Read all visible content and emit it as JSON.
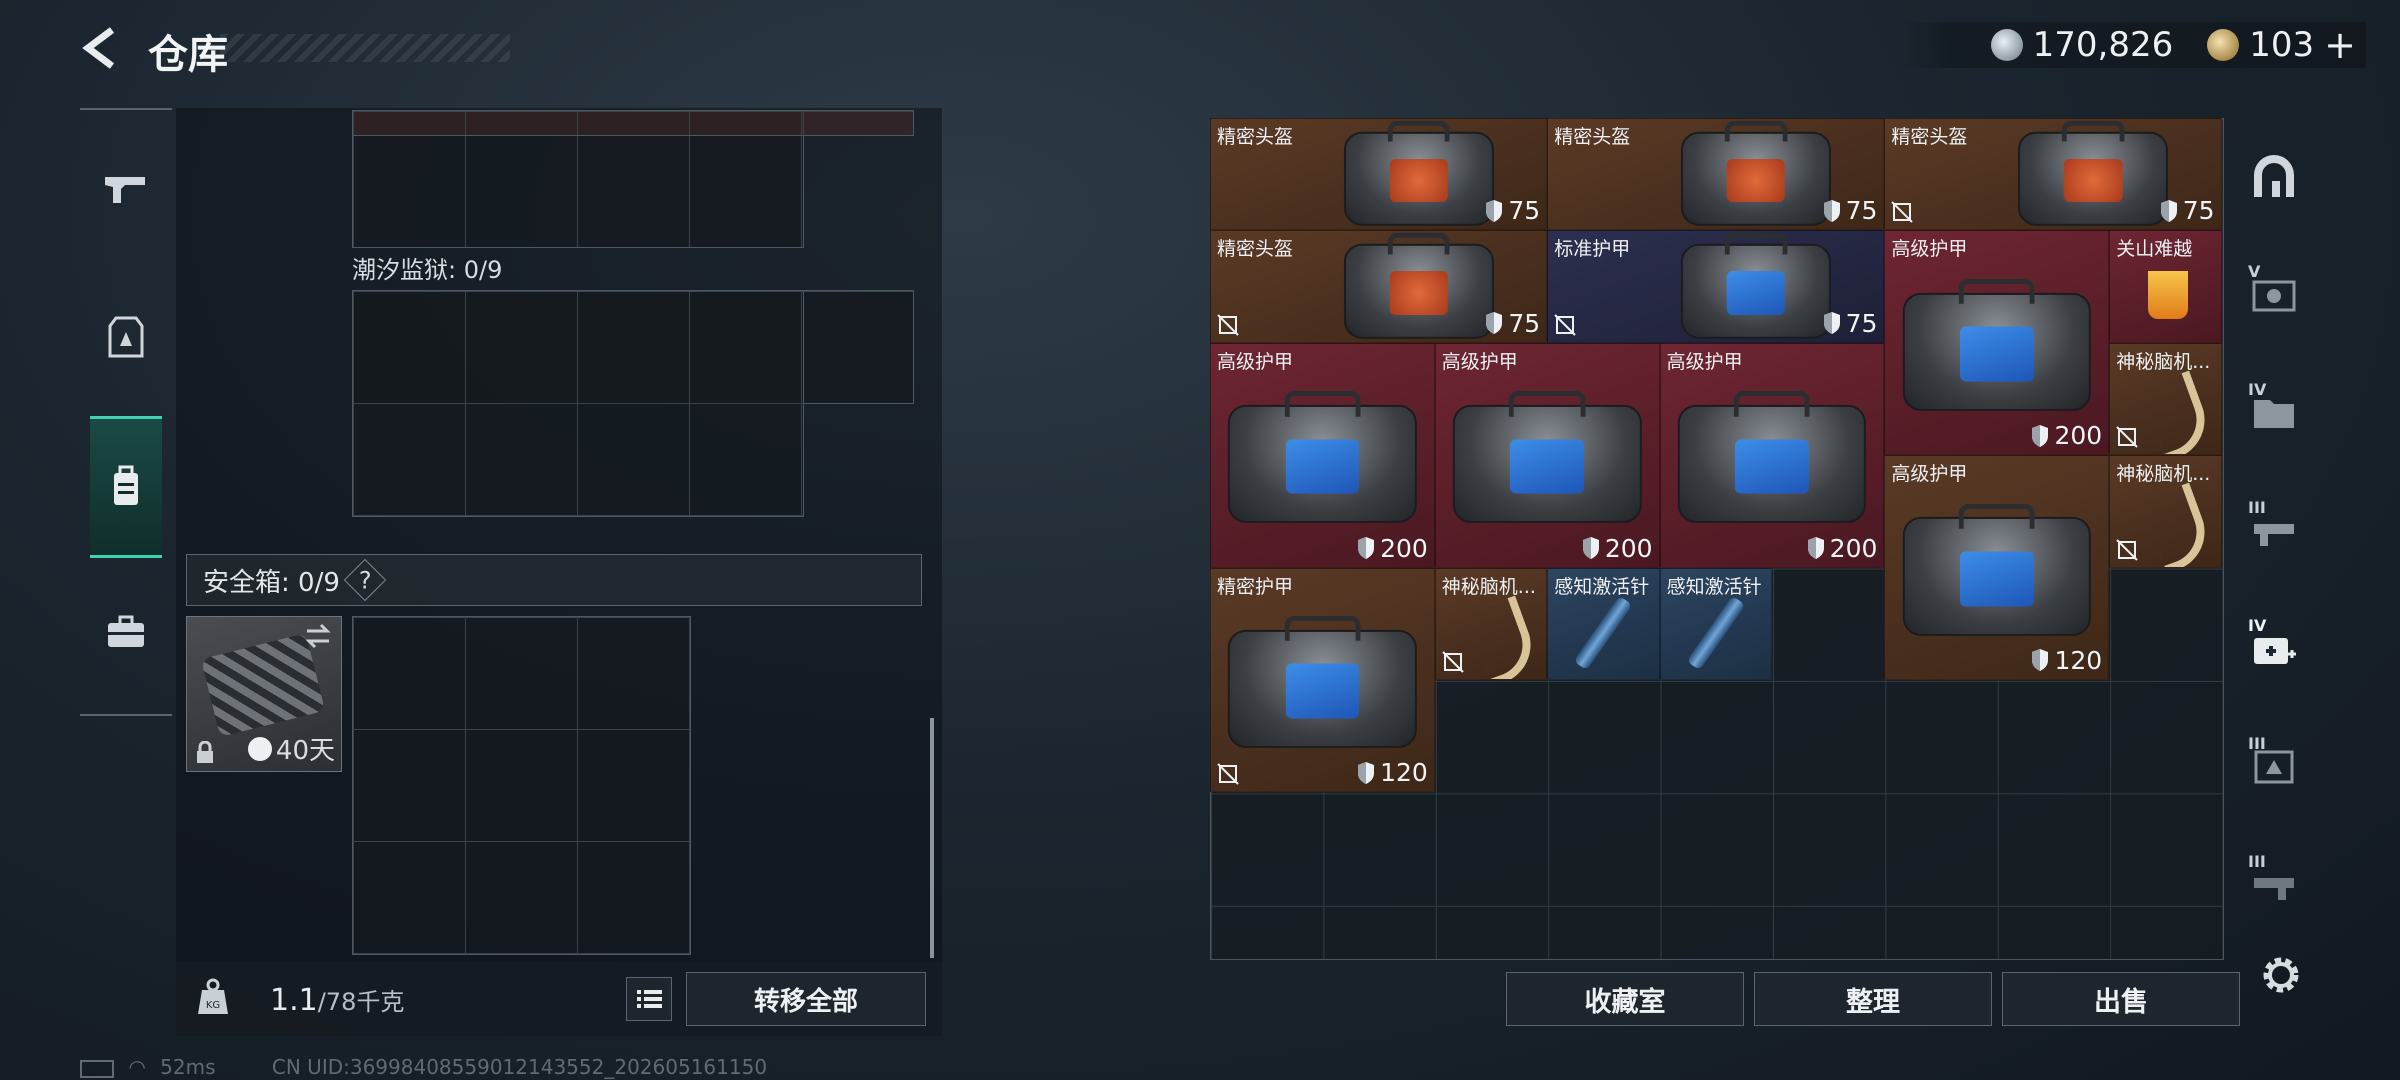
{
  "header": {
    "title": "仓库"
  },
  "currency": {
    "silver": "170,826",
    "gold": "103",
    "gold_add": "+"
  },
  "left": {
    "tide_prison_label": "潮汐监狱: 0/9",
    "safebox_label": "安全箱: 0/9",
    "safebox_help": "?",
    "safebox_timer": "40天",
    "weight_value": "1.1",
    "weight_max": "/78千克",
    "transfer_all": "转移全部"
  },
  "stash_items": [
    {
      "name": "精密头盔",
      "durability": "75",
      "color": "brown",
      "icon": "helmet-bag-icon",
      "nontransfer": false
    },
    {
      "name": "精密头盔",
      "durability": "75",
      "color": "brown",
      "icon": "helmet-bag-icon",
      "nontransfer": false
    },
    {
      "name": "精密头盔",
      "durability": "75",
      "color": "brown",
      "icon": "helmet-bag-icon",
      "nontransfer": true
    },
    {
      "name": "精密头盔",
      "durability": "75",
      "color": "brown",
      "icon": "helmet-bag-icon",
      "nontransfer": true
    },
    {
      "name": "标准护甲",
      "durability": "75",
      "color": "navy",
      "icon": "armor-bag-icon",
      "nontransfer": true
    },
    {
      "name": "高级护甲",
      "durability": "200",
      "color": "red",
      "icon": "armor-bag-icon",
      "nontransfer": false
    },
    {
      "name": "关山难越",
      "durability": "",
      "color": "red",
      "icon": "drink-icon",
      "nontransfer": false
    },
    {
      "name": "高级护甲",
      "durability": "200",
      "color": "red",
      "icon": "armor-bag-icon",
      "nontransfer": false
    },
    {
      "name": "高级护甲",
      "durability": "200",
      "color": "red",
      "icon": "armor-bag-icon",
      "nontransfer": false
    },
    {
      "name": "高级护甲",
      "durability": "200",
      "color": "red",
      "icon": "armor-bag-icon",
      "nontransfer": false
    },
    {
      "name": "神秘脑机...",
      "durability": "",
      "color": "brown",
      "icon": "brain-device-icon",
      "nontransfer": true
    },
    {
      "name": "高级护甲",
      "durability": "120",
      "color": "brown",
      "icon": "armor-bag-icon",
      "nontransfer": false
    },
    {
      "name": "神秘脑机...",
      "durability": "",
      "color": "brown",
      "icon": "brain-device-icon",
      "nontransfer": true
    },
    {
      "name": "精密护甲",
      "durability": "120",
      "color": "brown",
      "icon": "armor-bag-icon",
      "nontransfer": true
    },
    {
      "name": "神秘脑机...",
      "durability": "",
      "color": "brown",
      "icon": "brain-device-icon",
      "nontransfer": true
    },
    {
      "name": "感知激活针",
      "durability": "",
      "color": "blue",
      "icon": "syringe-icon",
      "nontransfer": false
    },
    {
      "name": "感知激活针",
      "durability": "",
      "color": "blue",
      "icon": "syringe-icon",
      "nontransfer": false
    }
  ],
  "right_nav": {
    "tiers": [
      "V",
      "IV",
      "III",
      "IV",
      "III",
      "III"
    ]
  },
  "actions": {
    "collection": "收藏室",
    "sort": "整理",
    "sell": "出售"
  },
  "status": {
    "ping": "52ms",
    "uid": "CN UID:36998408559012143552_202605161150"
  },
  "colors": {
    "accent": "#3fd1b2",
    "brown": "#5a3a26",
    "red": "#6e2633",
    "navy": "#2c2f4e",
    "blue": "#2d4560"
  }
}
